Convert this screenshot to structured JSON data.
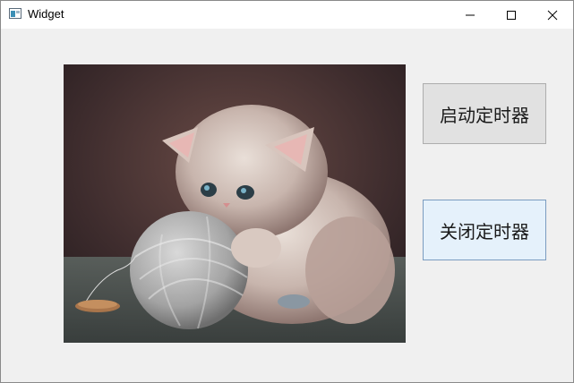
{
  "window": {
    "title": "Widget"
  },
  "controls": {
    "minimize_icon": "minimize-icon",
    "maximize_icon": "maximize-icon",
    "close_icon": "close-icon"
  },
  "image": {
    "subject": "kitten-with-yarn"
  },
  "buttons": {
    "start_label": "启动定时器",
    "stop_label": "关闭定时器"
  },
  "colors": {
    "button_face": "#e1e1e1",
    "button_focus": "#e5f1fb",
    "titlebar": "#ffffff",
    "window_bg": "#f0f0f0"
  }
}
